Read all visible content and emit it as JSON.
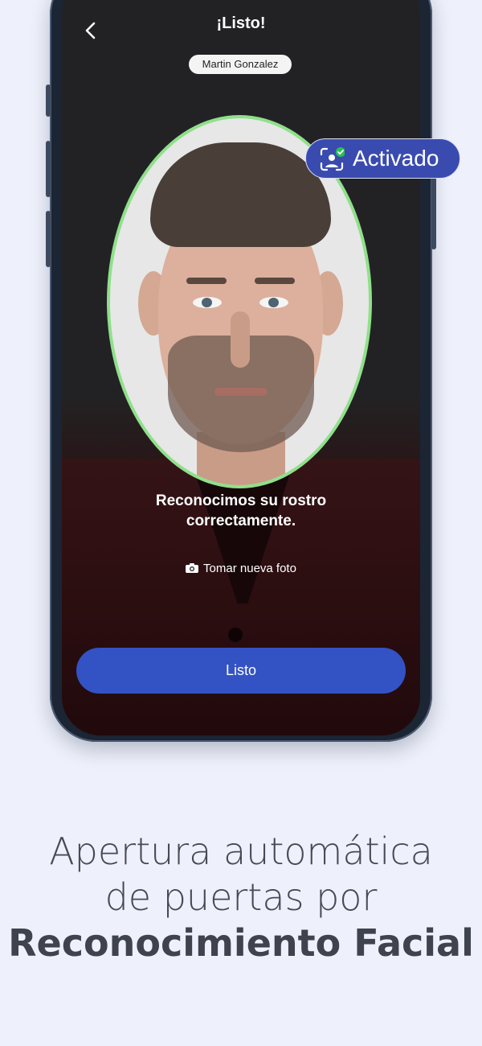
{
  "screen": {
    "title": "¡Listo!",
    "user_name": "Martin Gonzalez",
    "status_message": "Reconocimos su rostro correctamente.",
    "retake_label": "Tomar nueva foto",
    "primary_button": "Listo"
  },
  "badge": {
    "label": "Activado",
    "icon": "face-id-check-icon"
  },
  "promo": {
    "line1": "Apertura automática",
    "line2": "de puertas por",
    "line3": "Reconocimiento Facial"
  },
  "colors": {
    "background": "#eef1fb",
    "accent": "#3352c4",
    "badge": "#3a4bb0",
    "oval_border": "#8fe08a",
    "check": "#2bbf55"
  },
  "icons": {
    "back": "chevron-left-icon",
    "camera": "camera-icon"
  }
}
